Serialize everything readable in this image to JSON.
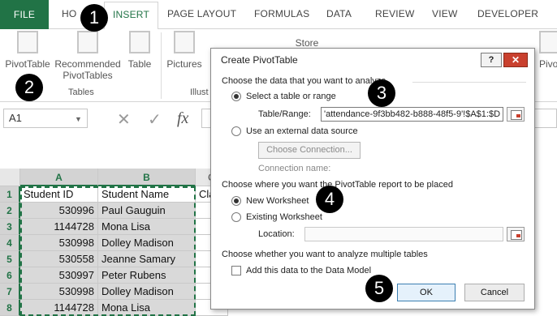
{
  "ribbon": {
    "tabs": [
      "FILE",
      "HOME",
      "INSERT",
      "PAGE LAYOUT",
      "FORMULAS",
      "DATA",
      "REVIEW",
      "VIEW",
      "DEVELOPER"
    ],
    "tabs_visible": {
      "file": "FILE",
      "home": "HO",
      "insert": "INSERT",
      "page_layout": "PAGE LAYOUT",
      "formulas": "FORMULAS",
      "data": "DATA",
      "review": "REVIEW",
      "view": "VIEW",
      "developer": "DEVELOPER"
    },
    "buttons": {
      "pivottable": "PivotTable",
      "recommended_line1": "Recommended",
      "recommended_line2": "PivotTables",
      "table": "Table",
      "pictures": "Pictures",
      "store": "Store",
      "pivotchart": "PivotCh"
    },
    "groups": {
      "tables": "Tables",
      "illustrations": "Illust"
    }
  },
  "formula_bar": {
    "name_box": "A1",
    "cancel_symbol": "✕",
    "enter_symbol": "✓",
    "fx_symbol": "fx"
  },
  "sheet": {
    "columns": [
      "A",
      "B",
      "C"
    ],
    "column_c_partial": "Cla",
    "rows": [
      {
        "num": "1",
        "a": "Student ID",
        "b": "Student Name"
      },
      {
        "num": "2",
        "a": "530996",
        "b": "Paul Gauguin"
      },
      {
        "num": "3",
        "a": "1144728",
        "b": "Mona Lisa"
      },
      {
        "num": "4",
        "a": "530998",
        "b": "Dolley Madison"
      },
      {
        "num": "5",
        "a": "530558",
        "b": "Jeanne Samary"
      },
      {
        "num": "6",
        "a": "530997",
        "b": "Peter Rubens"
      },
      {
        "num": "7",
        "a": "530998",
        "b": "Dolley Madison"
      },
      {
        "num": "8",
        "a": "1144728",
        "b": "Mona Lisa"
      }
    ]
  },
  "dialog": {
    "title": "Create PivotTable",
    "help_button": "?",
    "close_button": "✕",
    "section1": "Choose the data that you want to analyze",
    "radio_select_table": "Select a table or range",
    "table_range_label": "Table/Range:",
    "table_range_value": "'attendance-9f3bb482-b888-48f5-9'!$A$1:$D",
    "radio_external": "Use an external data source",
    "choose_connection": "Choose Connection...",
    "connection_name_label": "Connection name:",
    "section2": "Choose where you want the PivotTable report to be placed",
    "radio_new_ws": "New Worksheet",
    "radio_existing_ws": "Existing Worksheet",
    "location_label": "Location:",
    "section3": "Choose whether you want to analyze multiple tables",
    "checkbox_data_model": "Add this data to the Data Model",
    "ok": "OK",
    "cancel": "Cancel"
  },
  "callouts": [
    "1",
    "2",
    "3",
    "4",
    "5"
  ],
  "colors": {
    "excel_green": "#217346",
    "close_red": "#c9402e"
  }
}
